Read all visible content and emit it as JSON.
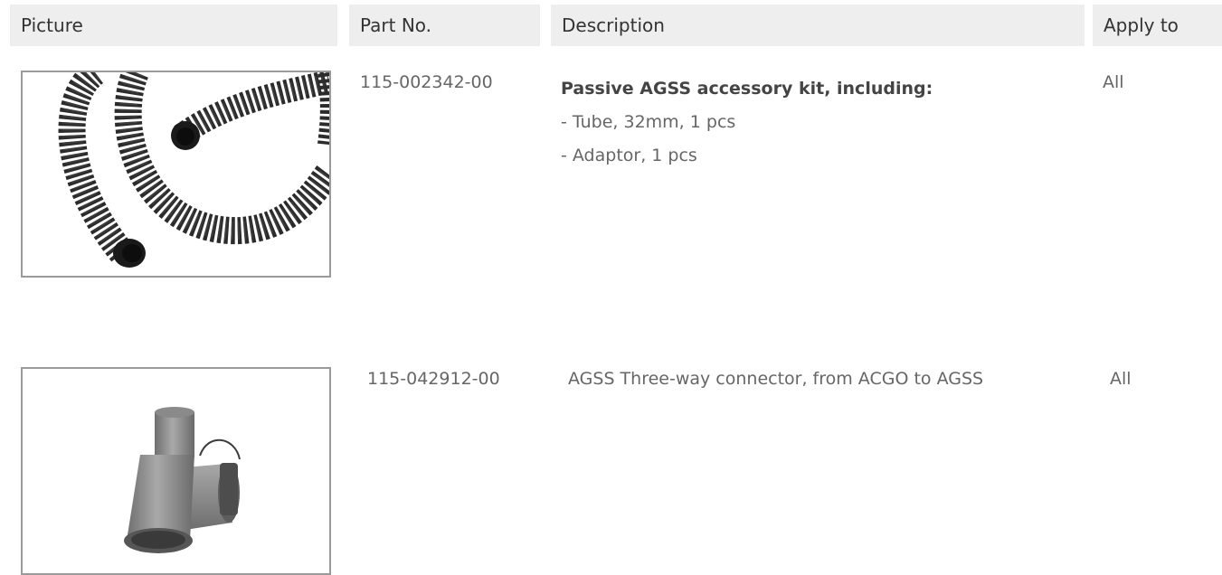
{
  "headers": {
    "picture": "Picture",
    "part_no": "Part No.",
    "description": "Description",
    "apply_to": "Apply to"
  },
  "rows": [
    {
      "part_no": "115-002342-00",
      "description_title": "Passive AGSS accessory kit, including:",
      "description_items": [
        "- Tube, 32mm, 1 pcs",
        "- Adaptor, 1 pcs"
      ],
      "apply_to": "All",
      "picture_icon": "corrugated-hose-icon"
    },
    {
      "part_no": "115-042912-00",
      "description": "AGSS Three-way connector, from ACGO to AGSS",
      "apply_to": "All",
      "picture_icon": "three-way-connector-icon"
    }
  ],
  "colors": {
    "header_bg": "#eeeeee",
    "image_border": "#9a9a9a",
    "hose": "#2e2e2e",
    "connector": "#8c8c8c"
  }
}
